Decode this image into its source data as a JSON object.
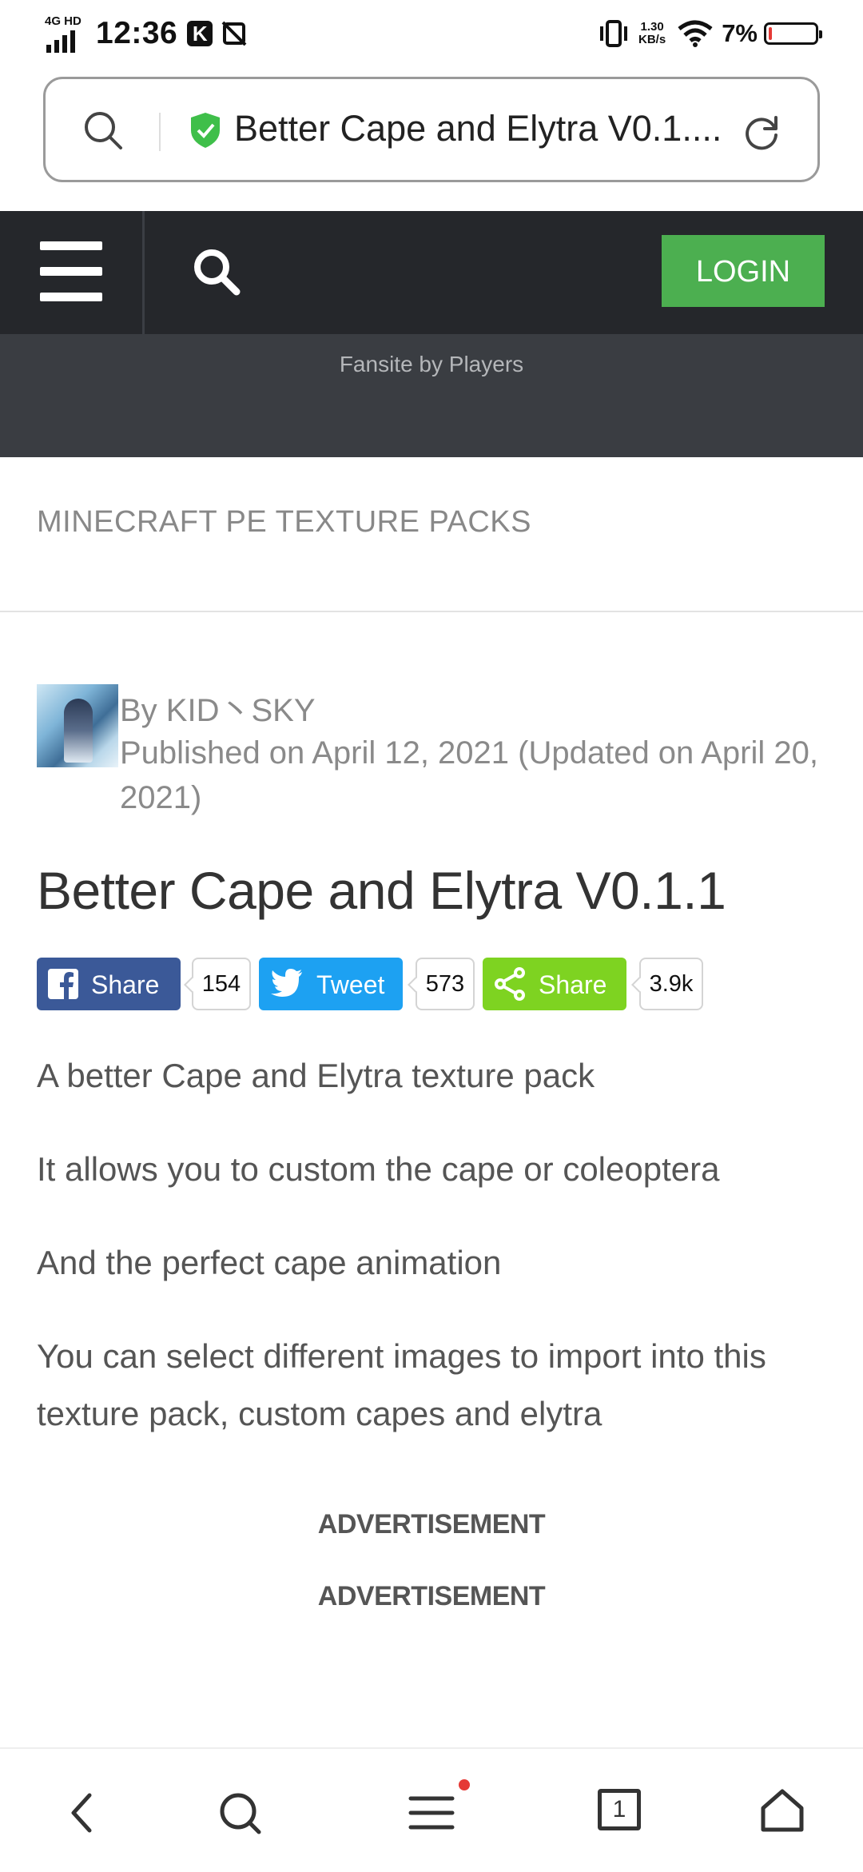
{
  "status_bar": {
    "network": "4G HD",
    "time": "12:36",
    "speed_value": "1.30",
    "speed_unit": "KB/s",
    "battery_percent": "7%",
    "battery_level": 0.07
  },
  "address_bar": {
    "title": "Better Cape and Elytra V0.1...."
  },
  "site_header": {
    "login_label": "LOGIN",
    "tagline": "Fansite by Players"
  },
  "breadcrumb": "MINECRAFT PE TEXTURE PACKS",
  "author": {
    "by_line": "By KID丶SKY",
    "published_line": "Published on April 12, 2021 (Updated on April 20, 2021)"
  },
  "article": {
    "title": "Better Cape and Elytra V0.1.1",
    "paragraphs": [
      "A better Cape and Elytra texture pack",
      "It allows you to custom the cape or coleoptera",
      "And the perfect cape animation",
      "You can select different images to import into this texture pack, custom capes and elytra"
    ]
  },
  "share": {
    "facebook": {
      "label": "Share",
      "count": "154",
      "color": "#3b5998"
    },
    "twitter": {
      "label": "Tweet",
      "count": "573",
      "color": "#1da1f2"
    },
    "generic": {
      "label": "Share",
      "count": "3.9k",
      "color": "#7ed321"
    }
  },
  "ads": [
    "ADVERTISEMENT",
    "ADVERTISEMENT"
  ],
  "bottom_nav": {
    "tab_count": "1"
  }
}
